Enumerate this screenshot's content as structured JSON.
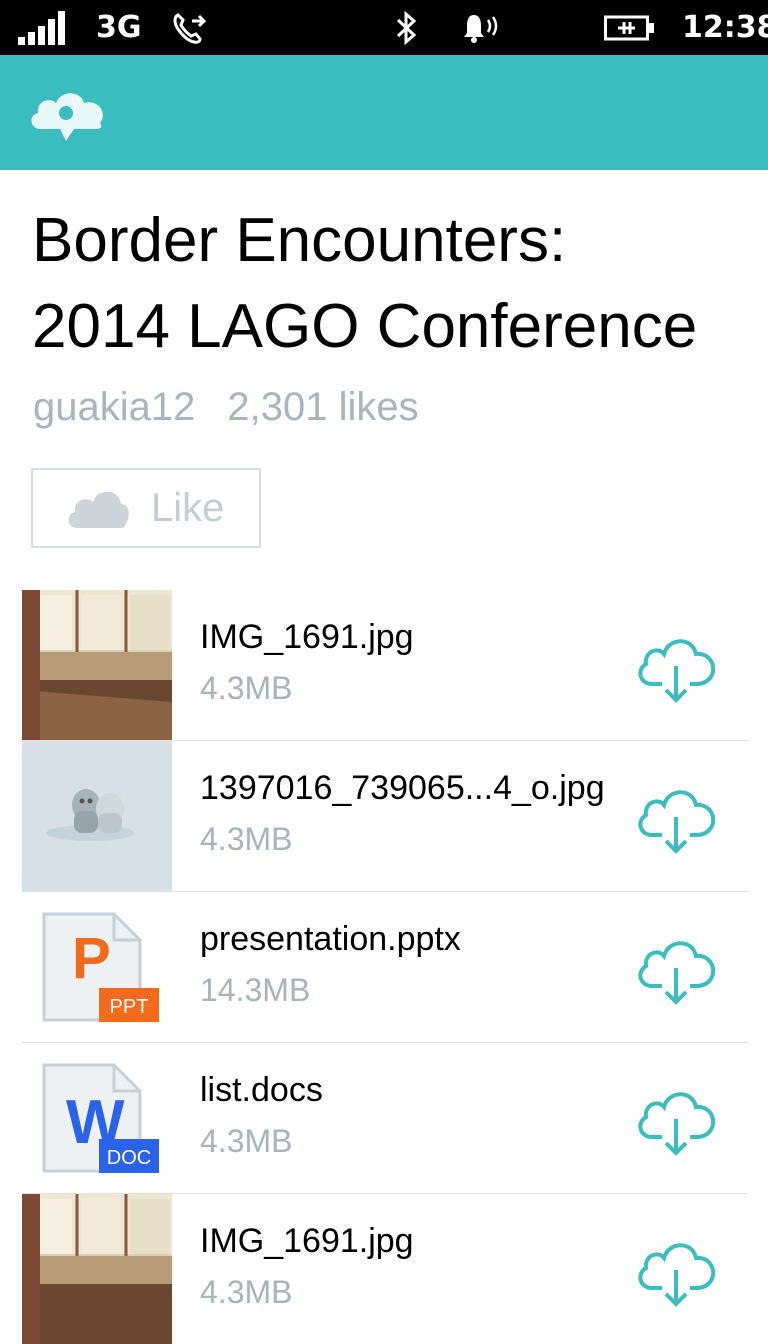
{
  "status_bar": {
    "network": "3G",
    "time": "12:38",
    "icons": [
      "signal-icon",
      "call-forwarding-icon",
      "bluetooth-icon",
      "ringer-vibrate-icon",
      "battery-charging-icon"
    ]
  },
  "header": {
    "logo_icon": "cloud-pin-logo-icon",
    "color": "#3bbdc0"
  },
  "collection": {
    "title_line1": "Border Encounters:",
    "title_line2": "2014 LAGO Conference",
    "owner": "guakia12",
    "likes": "2,301 likes",
    "like_button_label": "Like"
  },
  "files": [
    {
      "name": "IMG_1691.jpg",
      "size": "4.3MB",
      "thumb": "photo"
    },
    {
      "name": "1397016_739065...4_o.jpg",
      "size": "4.3MB",
      "thumb": "figure"
    },
    {
      "name": "presentation.pptx",
      "size": "14.3MB",
      "thumb": "ppt",
      "badge": "PPT",
      "letter": "P"
    },
    {
      "name": "list.docs",
      "size": "4.3MB",
      "thumb": "doc",
      "badge": "DOC",
      "letter": "W"
    },
    {
      "name": "IMG_1691.jpg",
      "size": "4.3MB",
      "thumb": "photo"
    }
  ],
  "colors": {
    "accent": "#3bbdc0",
    "ppt": "#f26b1d",
    "doc": "#2b63e8",
    "muted": "#a8b3ba"
  }
}
